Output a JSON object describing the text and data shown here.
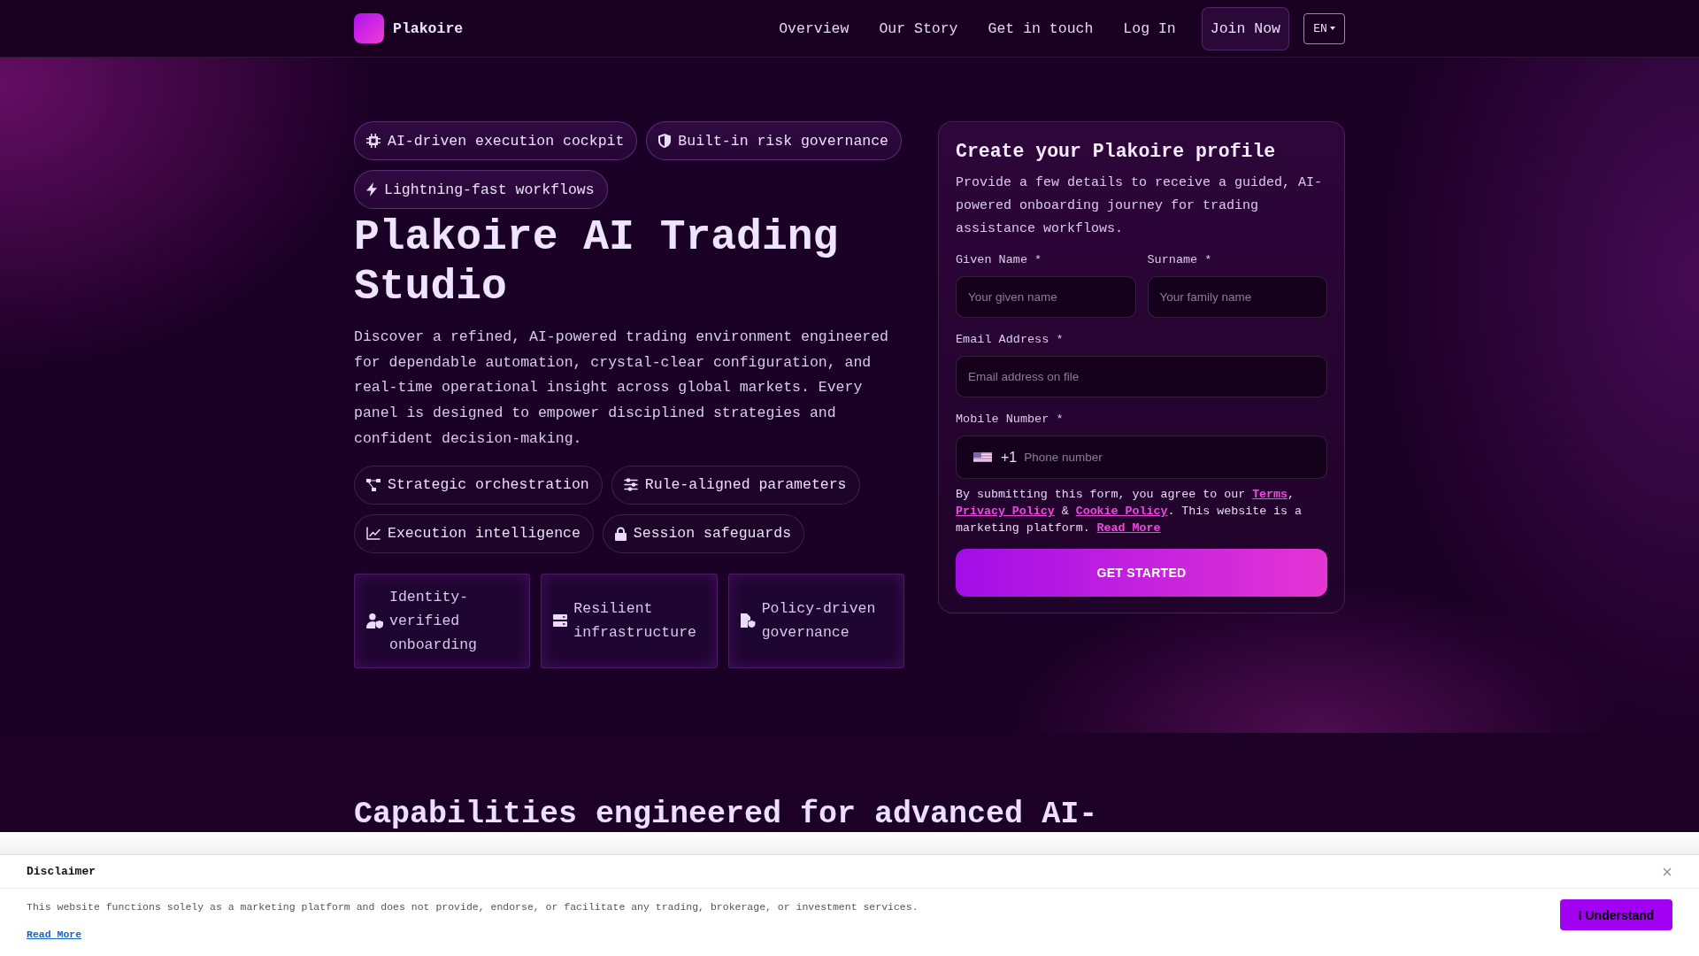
{
  "header": {
    "brand": "Plakoire",
    "nav": [
      "Overview",
      "Our Story",
      "Get in touch",
      "Log In"
    ],
    "join_button": "Join Now",
    "language": "EN"
  },
  "hero": {
    "highlights": [
      "AI-driven execution cockpit",
      "Built-in risk governance",
      "Lightning-fast workflows"
    ],
    "title": "Plakoire AI Trading Studio",
    "description": "Discover a refined, AI-powered trading environment engineered for dependable automation, crystal-clear configuration, and real-time operational insight across global markets. Every panel is designed to empower disciplined strategies and confident decision-making.",
    "features": [
      "Strategic orchestration",
      "Rule-aligned parameters",
      "Execution intelligence",
      "Session safeguards"
    ],
    "cards": [
      "Identity-verified onboarding",
      "Resilient infrastructure",
      "Policy-driven governance"
    ]
  },
  "form": {
    "title": "Create your Plakoire profile",
    "description": "Provide a few details to receive a guided, AI-powered onboarding journey for trading assistance workflows.",
    "rows": [
      [
        {
          "kind": "text",
          "label": "Given Name *",
          "placeholder": "Your given name"
        },
        {
          "kind": "text",
          "label": "Surname *",
          "placeholder": "Your family name"
        }
      ],
      [
        {
          "kind": "text",
          "label": "Email Address *",
          "placeholder": "Email address on file"
        }
      ],
      [
        {
          "kind": "phone",
          "label": "Mobile Number *",
          "dial_code": "+1",
          "placeholder": "Phone number"
        }
      ]
    ],
    "consent": [
      {
        "kind": "text",
        "text": "By submitting this form, you agree to our "
      },
      {
        "kind": "link",
        "text": "Terms"
      },
      {
        "kind": "text",
        "text": ", "
      },
      {
        "kind": "link",
        "text": "Privacy Policy"
      },
      {
        "kind": "text",
        "text": " & "
      },
      {
        "kind": "link",
        "text": "Cookie Policy"
      },
      {
        "kind": "text",
        "text": ". This website is a marketing platform. "
      },
      {
        "kind": "link",
        "text": "Read More"
      }
    ],
    "submit_button": "GET STARTED"
  },
  "capabilities": {
    "title": "Capabilities engineered for advanced AI-"
  },
  "disclaimer": {
    "title": "Disclaimer",
    "body": "This website functions solely as a marketing platform and does not provide, endorse, or facilitate any trading, brokerage, or investment services.",
    "link": "Read More",
    "button": "I Understand"
  }
}
